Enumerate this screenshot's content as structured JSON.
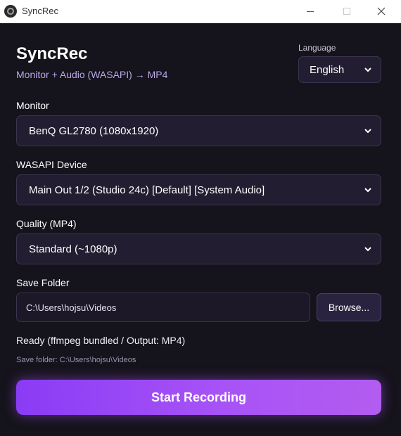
{
  "window": {
    "title": "SyncRec",
    "icon": "app-logo-icon",
    "controls": {
      "minimize": "minimize-icon",
      "maximize": "maximize-icon",
      "close": "✕"
    }
  },
  "header": {
    "title": "SyncRec",
    "subtitle": "Monitor + Audio (WASAPI) → MP4"
  },
  "language": {
    "label": "Language",
    "selected": "English"
  },
  "monitor": {
    "label": "Monitor",
    "selected": "BenQ GL2780 (1080x1920)"
  },
  "device": {
    "label": "WASAPI Device",
    "selected": "Main Out 1/2 (Studio 24c) [Default] [System Audio]"
  },
  "quality": {
    "label": "Quality (MP4)",
    "selected": "Standard (~1080p)"
  },
  "folder": {
    "label": "Save Folder",
    "value": "C:\\Users\\hojsu\\Videos",
    "browse_label": "Browse..."
  },
  "status": {
    "text": "Ready (ffmpeg bundled / Output: MP4)",
    "save_folder_text": "Save folder: C:\\Users\\hojsu\\Videos"
  },
  "actions": {
    "record_label": "Start Recording"
  },
  "colors": {
    "background": "#15131b",
    "accent": "#a752f7",
    "subtitle": "#b9a8ea"
  }
}
